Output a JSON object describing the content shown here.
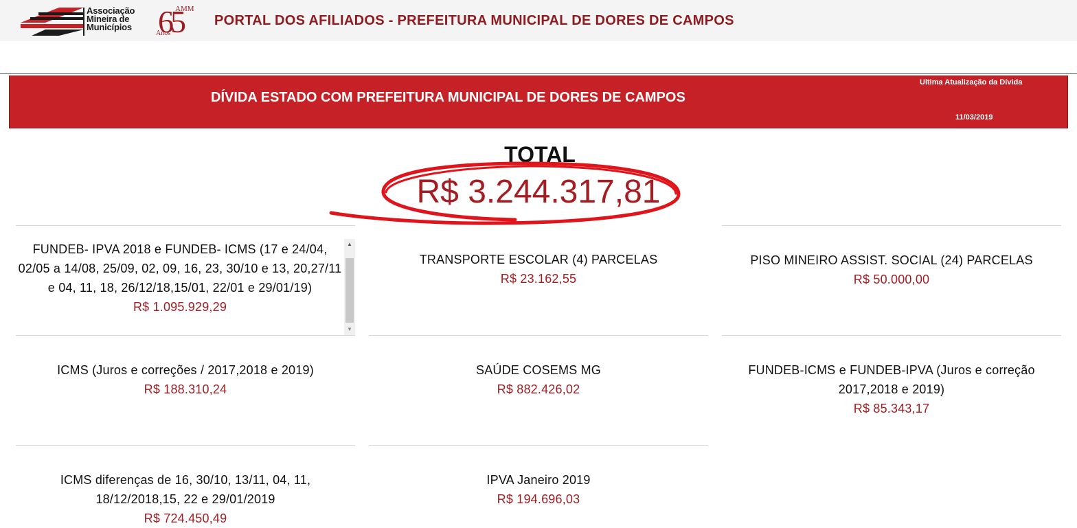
{
  "header": {
    "org_name": "Associação\nMineira de\nMunicípios",
    "anniv_number": "65",
    "anniv_amm": "AMM",
    "anniv_anos": "Anos",
    "portal_title": "PORTAL DOS AFILIADOS - PREFEITURA MUNICIPAL DE DORES DE CAMPOS"
  },
  "banner": {
    "title": "DÍVIDA ESTADO COM PREFEITURA MUNICIPAL DE DORES DE CAMPOS",
    "update_label": "Ultima Atualização da Dívida",
    "update_date": "11/03/2019"
  },
  "total": {
    "label": "TOTAL",
    "value": "R$ 3.244.317,81"
  },
  "cards": [
    {
      "title": "FUNDEB- IPVA 2018 e FUNDEB- ICMS (17 e 24/04, 02/05 a 14/08, 25/09, 02, 09, 16, 23, 30/10 e 13, 20,27/11 e 04, 11, 18, 26/12/18,15/01, 22/01 e 29/01/19)",
      "value": "R$ 1.095.929,29"
    },
    {
      "title": "TRANSPORTE ESCOLAR (4) PARCELAS",
      "value": "R$ 23.162,55"
    },
    {
      "title": "PISO MINEIRO ASSIST. SOCIAL (24) PARCELAS",
      "value": "R$ 50.000,00"
    },
    {
      "title": "ICMS (Juros e correções / 2017,2018 e 2019)",
      "value": "R$ 188.310,24"
    },
    {
      "title": "SAÚDE COSEMS MG",
      "value": "R$ 882.426,02"
    },
    {
      "title": "FUNDEB-ICMS e FUNDEB-IPVA (Juros e correção 2017,2018 e 2019)",
      "value": "R$ 85.343,17"
    },
    {
      "title": "ICMS diferenças de 16, 30/10, 13/11, 04, 11, 18/12/2018,15, 22 e 29/01/2019",
      "value": "R$ 724.450,49"
    },
    {
      "title": "IPVA Janeiro 2019",
      "value": "R$ 194.696,03"
    }
  ],
  "scrollbar": {
    "up_glyph": "▲",
    "down_glyph": "▼"
  },
  "colors": {
    "brand_red": "#c62127",
    "value_red": "#a31e22",
    "title_dark_red": "#8e1b1f"
  }
}
